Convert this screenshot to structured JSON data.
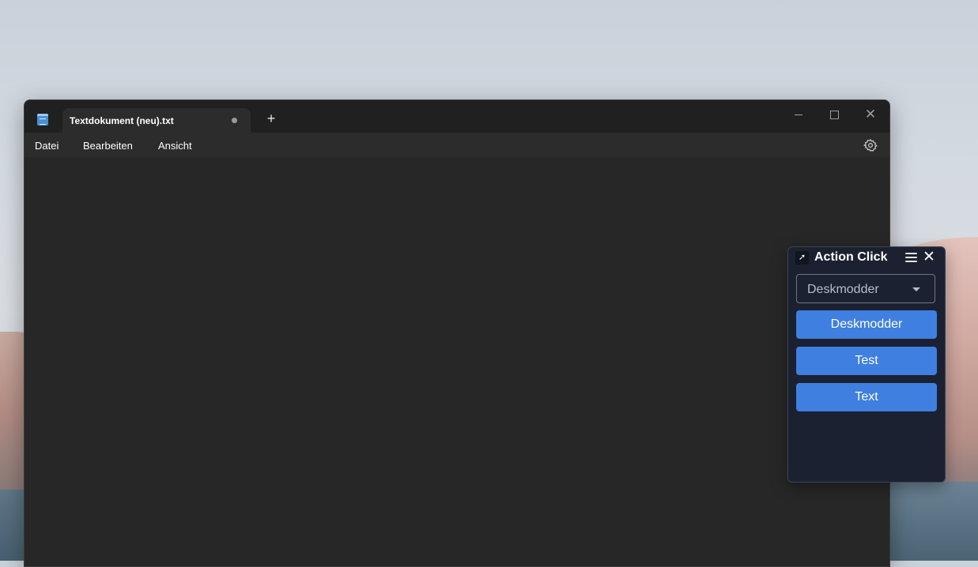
{
  "notepad": {
    "tab_title": "Textdokument (neu).txt",
    "new_tab_symbol": "+",
    "menu": {
      "file": "Datei",
      "edit": "Bearbeiten",
      "view": "Ansicht"
    },
    "controls": {
      "close_symbol": "✕"
    },
    "icons": {
      "app": "notepad-icon",
      "settings": "gear-icon",
      "unsaved": "unsaved-dot-icon"
    }
  },
  "action_click": {
    "title": "Action Click",
    "close_symbol": "✕",
    "select_value": "Deskmodder",
    "buttons": [
      "Deskmodder",
      "Test",
      "Text"
    ],
    "accent_color": "#3f7fe0",
    "icons": {
      "app": "cursor-click-icon",
      "menu": "hamburger-icon",
      "close": "close-icon",
      "dropdown": "caret-down-icon"
    }
  }
}
